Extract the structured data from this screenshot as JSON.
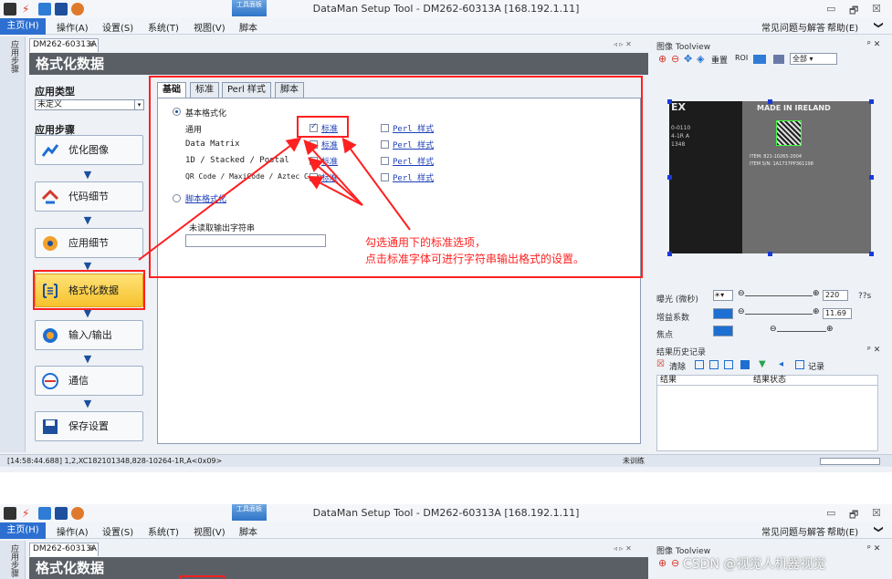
{
  "window": {
    "title": "DataMan Setup Tool - DM262-60313A [168.192.1.11]",
    "context_tab": "工具面板",
    "minimize": "▭",
    "restore": "🗗",
    "close": "☒"
  },
  "ribbon": {
    "tabs": [
      "主页(H)",
      "操作(A)",
      "设置(S)",
      "系统(T)",
      "视图(V)",
      "脚本"
    ],
    "faq": "常见问题与解答",
    "help": "帮助(E)",
    "chevron": "❯"
  },
  "side_strip": {
    "label": "应用步骤"
  },
  "doc_tab": {
    "label": "DM262-60313A",
    "close": "⊗",
    "nav": "◃ ▹ ✕"
  },
  "page": {
    "title": "格式化数据"
  },
  "left_panel": {
    "app_type_label": "应用类型",
    "app_type_value": "未定义",
    "steps_label": "应用步骤",
    "steps": [
      {
        "label": "优化图像",
        "icon": "optimize-icon"
      },
      {
        "label": "代码细节",
        "icon": "code-icon"
      },
      {
        "label": "应用细节",
        "icon": "app-icon"
      },
      {
        "label": "格式化数据",
        "icon": "format-icon"
      },
      {
        "label": "输入/输出",
        "icon": "io-icon"
      },
      {
        "label": "通信",
        "icon": "comm-icon"
      },
      {
        "label": "保存设置",
        "icon": "save-icon"
      }
    ]
  },
  "format": {
    "tabs": [
      "基础",
      "标准",
      "Perl 样式",
      "脚本"
    ],
    "basic_format": "基本格式化",
    "rows": [
      {
        "label": "通用",
        "checked": true
      },
      {
        "label": "Data Matrix",
        "checked": false
      },
      {
        "label": "1D / Stacked / Postal",
        "checked": false
      },
      {
        "label": "QR Code / MaxiCode / Aztec Code",
        "checked": false
      }
    ],
    "standard_link": "标准",
    "perl_link": "Perl 样式",
    "script_format": "脚本格式化",
    "unread_label": "未读取输出字符串",
    "unread_value": ""
  },
  "annotation": {
    "line1": "勾选通用下的标准选项，",
    "line2": "点击标准字体可进行字符串输出格式的设置。"
  },
  "right_panel": {
    "image_title": "图像 Toolview",
    "pin": "ᵖ ✕",
    "toolbar_reset": "重置",
    "toolbar_roi": "ROI",
    "toolbar_all": "全部",
    "exposure_label": "曝光 (微秒)",
    "exposure_value": "220",
    "exposure_unit": "??s",
    "gain_label": "增益系数",
    "gain_value": "11.69",
    "focus_label": "焦点",
    "history_title": "结果历史记录",
    "history_clear": "清除",
    "history_record": "记录",
    "col_result": "结果",
    "col_status": "结果状态",
    "image_text": {
      "made": "MADE IN IRELAND",
      "item1": "ITEM: 821-10265-2004",
      "item2": "ITEM S/N: 1A1737PP361198",
      "ex": "EX",
      "left1": "0-0110",
      "left2": "4-1R A",
      "left3": "1348"
    }
  },
  "status_bar": {
    "log": "[14:58:44.688] 1,2,XC182101348,828-10264-1R,A<0x09>",
    "train": "未训练"
  },
  "watermark": "CSDN @视觉人机器视觉",
  "colors": {
    "accent": "#2d6fd1",
    "annotation": "#ff2020",
    "active_step": "#f6c22e"
  }
}
